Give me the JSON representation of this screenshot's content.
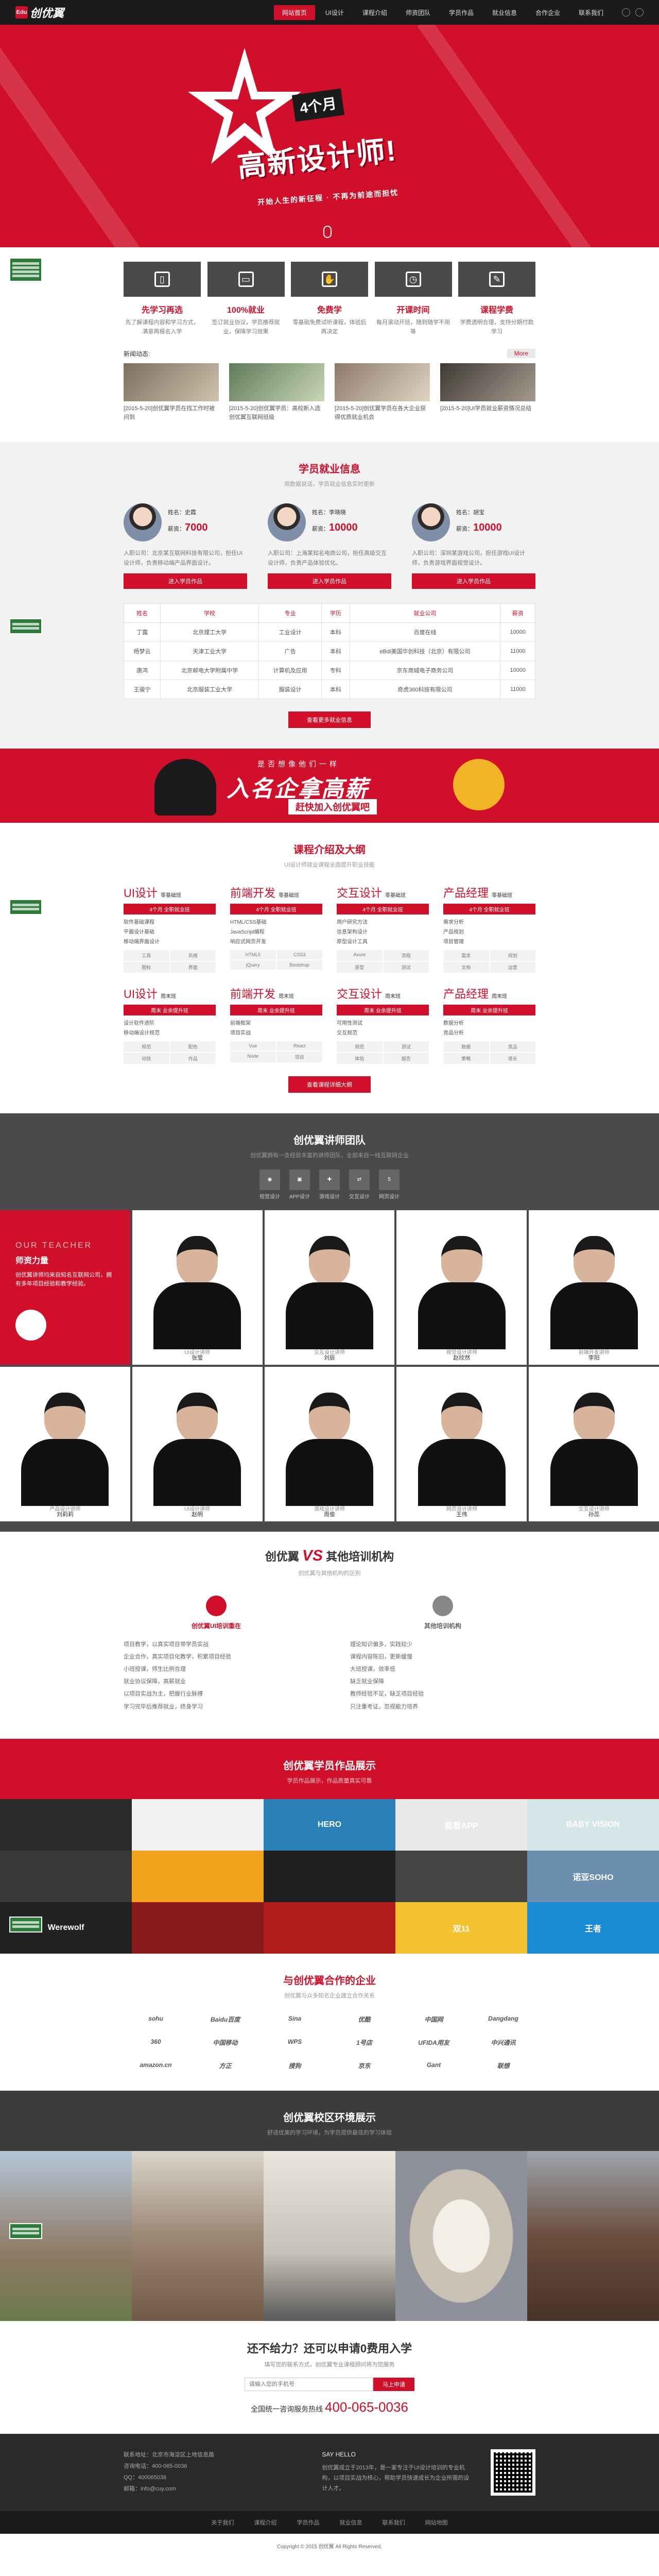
{
  "nav": {
    "logo_text": "创优翼",
    "logo_mark": "Edu",
    "items": [
      "网站首页",
      "UI设计",
      "课程介绍",
      "师资团队",
      "学员作品",
      "就业信息",
      "合作企业",
      "联系我们"
    ]
  },
  "hero": {
    "number": "4",
    "badge": "个月",
    "title": "高新设计师!",
    "tagline": "开始人生的新征程 · 不再为前途而担忧"
  },
  "features": [
    {
      "icon": "tablet-icon",
      "glyph": "▯",
      "title": "先学习再选",
      "desc": "先了解课程内容和学习方式，满意再报名入学"
    },
    {
      "icon": "monitor-icon",
      "glyph": "▭",
      "title": "100%就业",
      "desc": "签订就业协议，学员推荐就业，保障学习效果"
    },
    {
      "icon": "cursor-icon",
      "glyph": "✋",
      "title": "免费学",
      "desc": "零基础免费试听课程，体验后再决定"
    },
    {
      "icon": "clock-icon",
      "glyph": "◷",
      "title": "开课时间",
      "desc": "每月滚动开班，随到随学不用等"
    },
    {
      "icon": "pencil-icon",
      "glyph": "✎",
      "title": "课程学费",
      "desc": "学费透明合理，支持分期付款学习"
    }
  ],
  "news": {
    "label": "新闻动态:",
    "more": "More",
    "items": [
      "[2015-5-20]创优翼学员在找工作时被问到",
      "[2015-5-20]创优翼学员：高校新入选创优翼互联网班级",
      "[2015-5-20]创优翼学员在各大企业获得优质就业机会",
      "[2015-5-20]UI学员就业薪资情况总结"
    ]
  },
  "employment": {
    "title": "学员就业信息",
    "subtitle": "用数据说话，学员就业信息实时更新",
    "stars": [
      {
        "name_label": "姓名：史霞",
        "salary_label": "薪资：",
        "salary": "7000",
        "desc": "入职公司：北京某互联网科技有限公司，担任UI设计师，负责移动端产品界面设计。",
        "btn": "进入学员作品"
      },
      {
        "name_label": "姓名：李晓晓",
        "salary_label": "薪资：",
        "salary": "10000",
        "desc": "入职公司：上海某知名电商公司，担任高级交互设计师，负责产品体验优化。",
        "btn": "进入学员作品"
      },
      {
        "name_label": "姓名：胡宝",
        "salary_label": "薪资：",
        "salary": "10000",
        "desc": "入职公司：深圳某游戏公司，担任游戏UI设计师，负责游戏界面视觉设计。",
        "btn": "进入学员作品"
      }
    ],
    "table": {
      "headers": [
        "姓名",
        "学校",
        "专业",
        "学历",
        "就业公司",
        "薪资"
      ],
      "rows": [
        [
          "丁露",
          "北京理工大学",
          "工业设计",
          "本科",
          "百度在线",
          "10000"
        ],
        [
          "杨梦云",
          "天津工业大学",
          "广告",
          "本科",
          "eBdi美国华创科技（北京）有限公司",
          "11000"
        ],
        [
          "唐鸿",
          "北京邮电大学附属中学",
          "计算机及应用",
          "专科",
          "京东商城电子商务公司",
          "10000"
        ],
        [
          "王骏宁",
          "北京服装工业大学",
          "服装设计",
          "本科",
          "奇虎360科技有限公司",
          "11000"
        ]
      ]
    },
    "btn": "查看更多就业信息"
  },
  "banner2": {
    "small": "是否想像他们一样",
    "main": "入名企拿高薪",
    "strap": "赶快加入创优翼吧"
  },
  "courses": {
    "title": "课程介绍及大纲",
    "subtitle": "UI设计师就业课程全面提升职业技能",
    "items": [
      {
        "name": "UI设计",
        "tag": "零基础班",
        "pill": "4个月 全职就业班",
        "lines": [
          "软件基础课程",
          "平面设计基础",
          "移动端界面设计"
        ],
        "cells": [
          "工具",
          "风格",
          "图标",
          "界面"
        ]
      },
      {
        "name": "前端开发",
        "tag": "零基础班",
        "pill": "4个月 全职就业班",
        "lines": [
          "HTML/CSS基础",
          "JavaScript编程",
          "响应式网页开发"
        ],
        "cells": [
          "HTML5",
          "CSS3",
          "jQuery",
          "Bootstrap"
        ]
      },
      {
        "name": "交互设计",
        "tag": "零基础班",
        "pill": "4个月 全职就业班",
        "lines": [
          "用户研究方法",
          "信息架构设计",
          "原型设计工具"
        ],
        "cells": [
          "Axure",
          "流程",
          "原型",
          "测试"
        ]
      },
      {
        "name": "产品经理",
        "tag": "零基础班",
        "pill": "4个月 全职就业班",
        "lines": [
          "需求分析",
          "产品规划",
          "项目管理"
        ],
        "cells": [
          "需求",
          "规划",
          "文档",
          "运营"
        ]
      },
      {
        "name": "UI设计",
        "tag": "周末班",
        "pill": "周末 业余提升班",
        "lines": [
          "设计软件进阶",
          "移动端设计规范"
        ],
        "cells": [
          "规范",
          "配色",
          "动效",
          "作品"
        ]
      },
      {
        "name": "前端开发",
        "tag": "周末班",
        "pill": "周末 业余提升班",
        "lines": [
          "前端框架",
          "项目实战"
        ],
        "cells": [
          "Vue",
          "React",
          "Node",
          "项目"
        ]
      },
      {
        "name": "交互设计",
        "tag": "周末班",
        "pill": "周末 业余提升班",
        "lines": [
          "可用性测试",
          "交互规范"
        ],
        "cells": [
          "规范",
          "测试",
          "体验",
          "报告"
        ]
      },
      {
        "name": "产品经理",
        "tag": "周末班",
        "pill": "周末 业余提升班",
        "lines": [
          "数据分析",
          "竞品分析"
        ],
        "cells": [
          "数据",
          "竞品",
          "策略",
          "增长"
        ]
      }
    ],
    "btn": "查看课程详细大纲"
  },
  "teachers": {
    "title": "创优翼讲师团队",
    "subtitle": "创优翼拥有一支经验丰富的讲师团队，全部来自一线互联网企业",
    "skills": [
      "视觉设计",
      "APP设计",
      "游戏设计",
      "交互设计",
      "网页设计"
    ],
    "intro_en": "OUR TEACHER",
    "intro_cn": "师资力量",
    "intro_desc": "创优翼讲师均来自知名互联网公司，拥有多年项目经验和教学经验。",
    "people": [
      {
        "name": "张莹",
        "role": "UI设计讲师"
      },
      {
        "name": "刘辰",
        "role": "交互设计讲师"
      },
      {
        "name": "赵欣然",
        "role": "视觉设计讲师"
      },
      {
        "name": "李阳",
        "role": "前端开发讲师"
      },
      {
        "name": "刘莉莉",
        "role": "产品设计讲师"
      },
      {
        "name": "赵明",
        "role": "UI设计讲师"
      },
      {
        "name": "周俊",
        "role": "游戏设计讲师"
      },
      {
        "name": "王伟",
        "role": "网页设计讲师"
      },
      {
        "name": "孙蕊",
        "role": "交互设计讲师"
      }
    ]
  },
  "vs": {
    "left": "创优翼",
    "v": "VS",
    "right": "其他培训机构",
    "sub": "创优翼与其他机构的区别",
    "col1_title": "创优翼UI培训重在",
    "col1": [
      "项目教学，以真实项目带学员实战",
      "企业合作，真实项目化教学，积累项目经验",
      "小班授课，师生比例合理",
      "就业协议保障，高薪就业",
      "以项目实战为主，把握行业脉搏",
      "学习完毕后推荐就业，终身学习"
    ],
    "col2_title": "其他培训机构",
    "col2": [
      "理论知识偏多，实践较少",
      "课程内容陈旧，更新缓慢",
      "大班授课，效率低",
      "缺乏就业保障",
      "教师经验不足，缺乏项目经验",
      "只注重考证，忽视能力培养"
    ]
  },
  "works": {
    "title": "创优翼学员作品展示",
    "subtitle": "学员作品展示，作品质量真实可靠",
    "tiles": [
      "",
      "",
      "HERO",
      "能看APP",
      "BABY VISION",
      "",
      "",
      "",
      "",
      "诺亚SOHO",
      "Werewolf",
      "",
      "",
      "双11",
      "王者"
    ]
  },
  "partners": {
    "title": "与创优翼合作的企业",
    "subtitle": "创优翼与众多知名企业建立合作关系",
    "logos": [
      "sohu",
      "Baidu百度",
      "Sina",
      "优酷",
      "中国网",
      "Dangdang",
      "360",
      "中国移动",
      "WPS",
      "1号店",
      "UFIDA用友",
      "中兴通讯",
      "amazon.cn",
      "方正",
      "搜狗",
      "京东",
      "Gant",
      "联想"
    ]
  },
  "campus": {
    "title": "创优翼校区环境展示",
    "subtitle": "舒适优美的学习环境，为学员提供最佳的学习体验"
  },
  "cta": {
    "title": "还不给力？还可以申请0费用入学",
    "sub": "填写您的联系方式，创优翼专业课程顾问将为您服务",
    "placeholder": "请输入您的手机号",
    "btn": "马上申请",
    "hotline_label": "全国统一咨询服务热线",
    "hotline": "400-065-0036"
  },
  "footer": {
    "col1": [
      "联系地址：北京市海淀区上地信息路",
      "咨询电话：400-065-0036",
      "QQ：400065036",
      "邮箱：info@cuy.com"
    ],
    "col2_title": "SAY HELLO",
    "col2": "创优翼成立于2013年，是一家专注于UI设计培训的专业机构，以项目实战为核心，帮助学员快速成长为企业所需的设计人才。",
    "links": [
      "关于我们",
      "课程介绍",
      "学员作品",
      "就业信息",
      "联系我们",
      "网站地图"
    ],
    "copyright": "Copyright © 2015 创优翼 All Rights Reserved."
  }
}
